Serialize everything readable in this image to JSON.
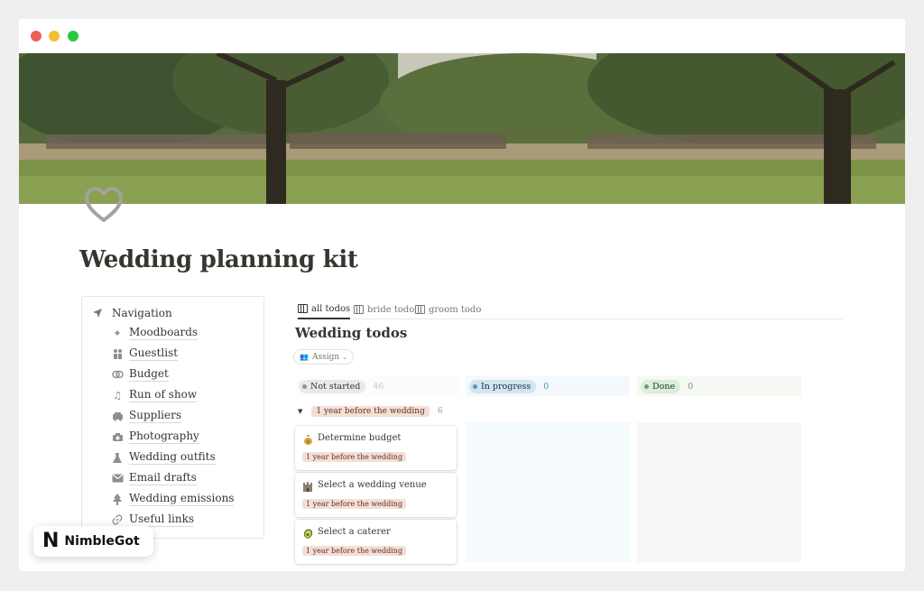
{
  "window": {
    "traffic_lights": [
      "close",
      "minimize",
      "zoom"
    ]
  },
  "page": {
    "title": "Wedding planning kit",
    "icon": "heart-icon"
  },
  "navigation": {
    "heading": "Navigation",
    "heading_icon": "arrow-icon",
    "items": [
      {
        "label": "Moodboards",
        "icon": "sparkles-icon"
      },
      {
        "label": "Guestlist",
        "icon": "people-icon"
      },
      {
        "label": "Budget",
        "icon": "coins-icon"
      },
      {
        "label": "Run of show",
        "icon": "music-note-icon"
      },
      {
        "label": "Suppliers",
        "icon": "car-icon"
      },
      {
        "label": "Photography",
        "icon": "camera-icon"
      },
      {
        "label": "Wedding outfits",
        "icon": "dress-icon"
      },
      {
        "label": "Email drafts",
        "icon": "mail-icon"
      },
      {
        "label": "Wedding emissions",
        "icon": "tree-icon"
      },
      {
        "label": "Useful links",
        "icon": "link-icon"
      }
    ]
  },
  "tabs": [
    {
      "label": "all todos",
      "active": true
    },
    {
      "label": "bride todo",
      "active": false
    },
    {
      "label": "groom todo",
      "active": false
    }
  ],
  "database": {
    "title": "Wedding todos",
    "assign_label": "Assign"
  },
  "columns": [
    {
      "label": "Not started",
      "count": "46",
      "color": "#91918e"
    },
    {
      "label": "In progress",
      "count": "0",
      "color": "#5b97bd"
    },
    {
      "label": "Done",
      "count": "0",
      "color": "#6c9b7d"
    }
  ],
  "group": {
    "label": "1 year before the wedding",
    "count": "6"
  },
  "cards": [
    {
      "title": "Determine budget",
      "emoji": "💰",
      "tag": "1 year before the wedding"
    },
    {
      "title": "Select a wedding venue",
      "emoji": "🏰",
      "tag": "1 year before the wedding"
    },
    {
      "title": "Select a caterer",
      "emoji": "🥑",
      "tag": "1 year before the wedding"
    }
  ],
  "watermark": {
    "letter": "N",
    "text": "NimbleGot"
  }
}
